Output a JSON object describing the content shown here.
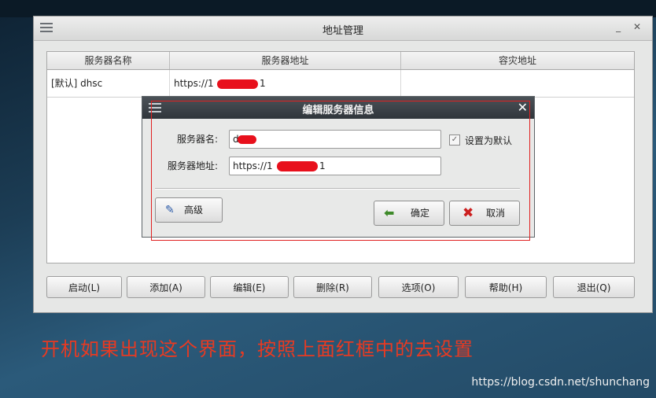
{
  "main_window": {
    "title": "地址管理",
    "window_controls": "_ ✕",
    "columns": [
      "服务器名称",
      "服务器地址",
      "容灾地址"
    ],
    "rows": [
      {
        "name": "[默认] dhsc",
        "address_prefix": "https://1",
        "address_suffix": "1",
        "backup": ""
      }
    ],
    "buttons": {
      "start": "启动(L)",
      "add": "添加(A)",
      "edit": "编辑(E)",
      "delete": "删除(R)",
      "options": "选项(O)",
      "help": "帮助(H)",
      "exit": "退出(Q)"
    }
  },
  "dialog": {
    "title": "编辑服务器信息",
    "name_label": "服务器名:",
    "name_value": "d",
    "address_label": "服务器地址:",
    "address_prefix": "https://1",
    "address_suffix": "1",
    "default_label": "设置为默认",
    "default_checked": true,
    "advanced_button": "高级",
    "ok_button": "确定",
    "cancel_button": "取消"
  },
  "annotation": {
    "caption": "开机如果出现这个界面，按照上面红框中的去设置",
    "highlight_color": "#e02020"
  },
  "watermark": "https://blog.csdn.net/shunchang",
  "colors": {
    "redaction": "#e8101c",
    "dialog_titlebar": "#30363b"
  }
}
